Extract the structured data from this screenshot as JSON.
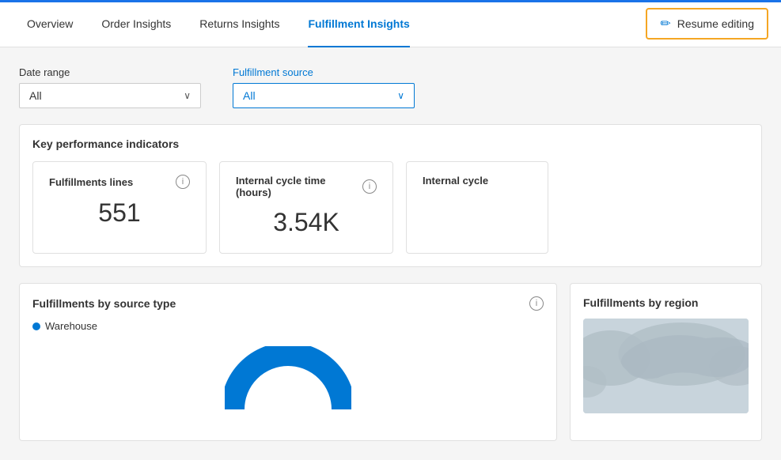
{
  "topbar": {
    "accent_color": "#1a73e8",
    "tabs": [
      {
        "id": "overview",
        "label": "Overview",
        "active": false
      },
      {
        "id": "order-insights",
        "label": "Order Insights",
        "active": false
      },
      {
        "id": "returns-insights",
        "label": "Returns Insights",
        "active": false
      },
      {
        "id": "fulfillment-insights",
        "label": "Fulfillment Insights",
        "active": true
      }
    ],
    "resume_editing_label": "Resume editing"
  },
  "filters": {
    "date_range_label": "Date range",
    "date_range_value": "All",
    "fulfillment_source_label": "Fulfillment source",
    "fulfillment_source_value": "All"
  },
  "kpi": {
    "section_title": "Key performance indicators",
    "cards": [
      {
        "id": "fulfillment-lines",
        "title": "Fulfillments lines",
        "value": "551"
      },
      {
        "id": "internal-cycle-time",
        "title": "Internal cycle time (hours)",
        "value": "3.54K"
      },
      {
        "id": "internal-cycle-partial",
        "title": "Internal cycle",
        "value": ""
      }
    ]
  },
  "panels": {
    "source_type": {
      "title": "Fulfillments by source type",
      "legend": [
        {
          "label": "Warehouse",
          "color": "#0078d4"
        }
      ]
    },
    "region": {
      "title": "Fulfillments by region"
    }
  },
  "icons": {
    "pencil": "✏",
    "info": "i",
    "chevron_down": "∨"
  }
}
